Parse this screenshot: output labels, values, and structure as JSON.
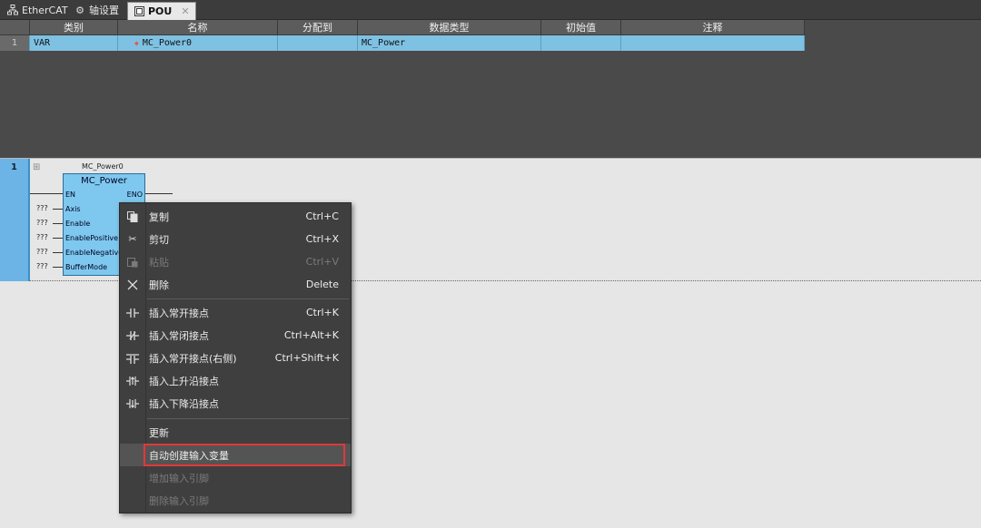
{
  "tabs": [
    {
      "label": "EtherCAT",
      "icon": "network-icon"
    },
    {
      "label": "轴设置",
      "icon": "gear-icon"
    },
    {
      "label": "POU",
      "icon": "pou-icon",
      "active": true
    }
  ],
  "variable_table": {
    "headers": [
      "类别",
      "名称",
      "分配到",
      "数据类型",
      "初始值",
      "注释"
    ],
    "rows": [
      {
        "index": "1",
        "category": "VAR",
        "name": "MC_Power0",
        "assign": "",
        "datatype": "MC_Power",
        "initial": "",
        "comment": ""
      }
    ]
  },
  "ladder": {
    "rung_number": "1",
    "fb_instance": "MC_Power0",
    "fb_type": "MC_Power",
    "pins": {
      "en": "EN",
      "eno": "ENO",
      "axis": "Axis",
      "enable": "Enable",
      "enable_positive": "EnablePositive",
      "enable_negative": "EnableNegative",
      "buffer_mode": "BufferMode"
    },
    "unassigned": "???"
  },
  "context_menu": {
    "copy": {
      "label": "复制",
      "shortcut": "Ctrl+C"
    },
    "cut": {
      "label": "剪切",
      "shortcut": "Ctrl+X"
    },
    "paste": {
      "label": "粘贴",
      "shortcut": "Ctrl+V"
    },
    "delete": {
      "label": "删除",
      "shortcut": "Delete"
    },
    "insert_no": {
      "label": "插入常开接点",
      "shortcut": "Ctrl+K"
    },
    "insert_nc": {
      "label": "插入常闭接点",
      "shortcut": "Ctrl+Alt+K"
    },
    "insert_no_right": {
      "label": "插入常开接点(右侧)",
      "shortcut": "Ctrl+Shift+K"
    },
    "insert_rising": {
      "label": "插入上升沿接点"
    },
    "insert_falling": {
      "label": "插入下降沿接点"
    },
    "update": {
      "label": "更新"
    },
    "auto_create": {
      "label": "自动创建输入变量"
    },
    "add_input_pin": {
      "label": "增加输入引脚"
    },
    "delete_input_pin": {
      "label": "删除输入引脚"
    }
  }
}
